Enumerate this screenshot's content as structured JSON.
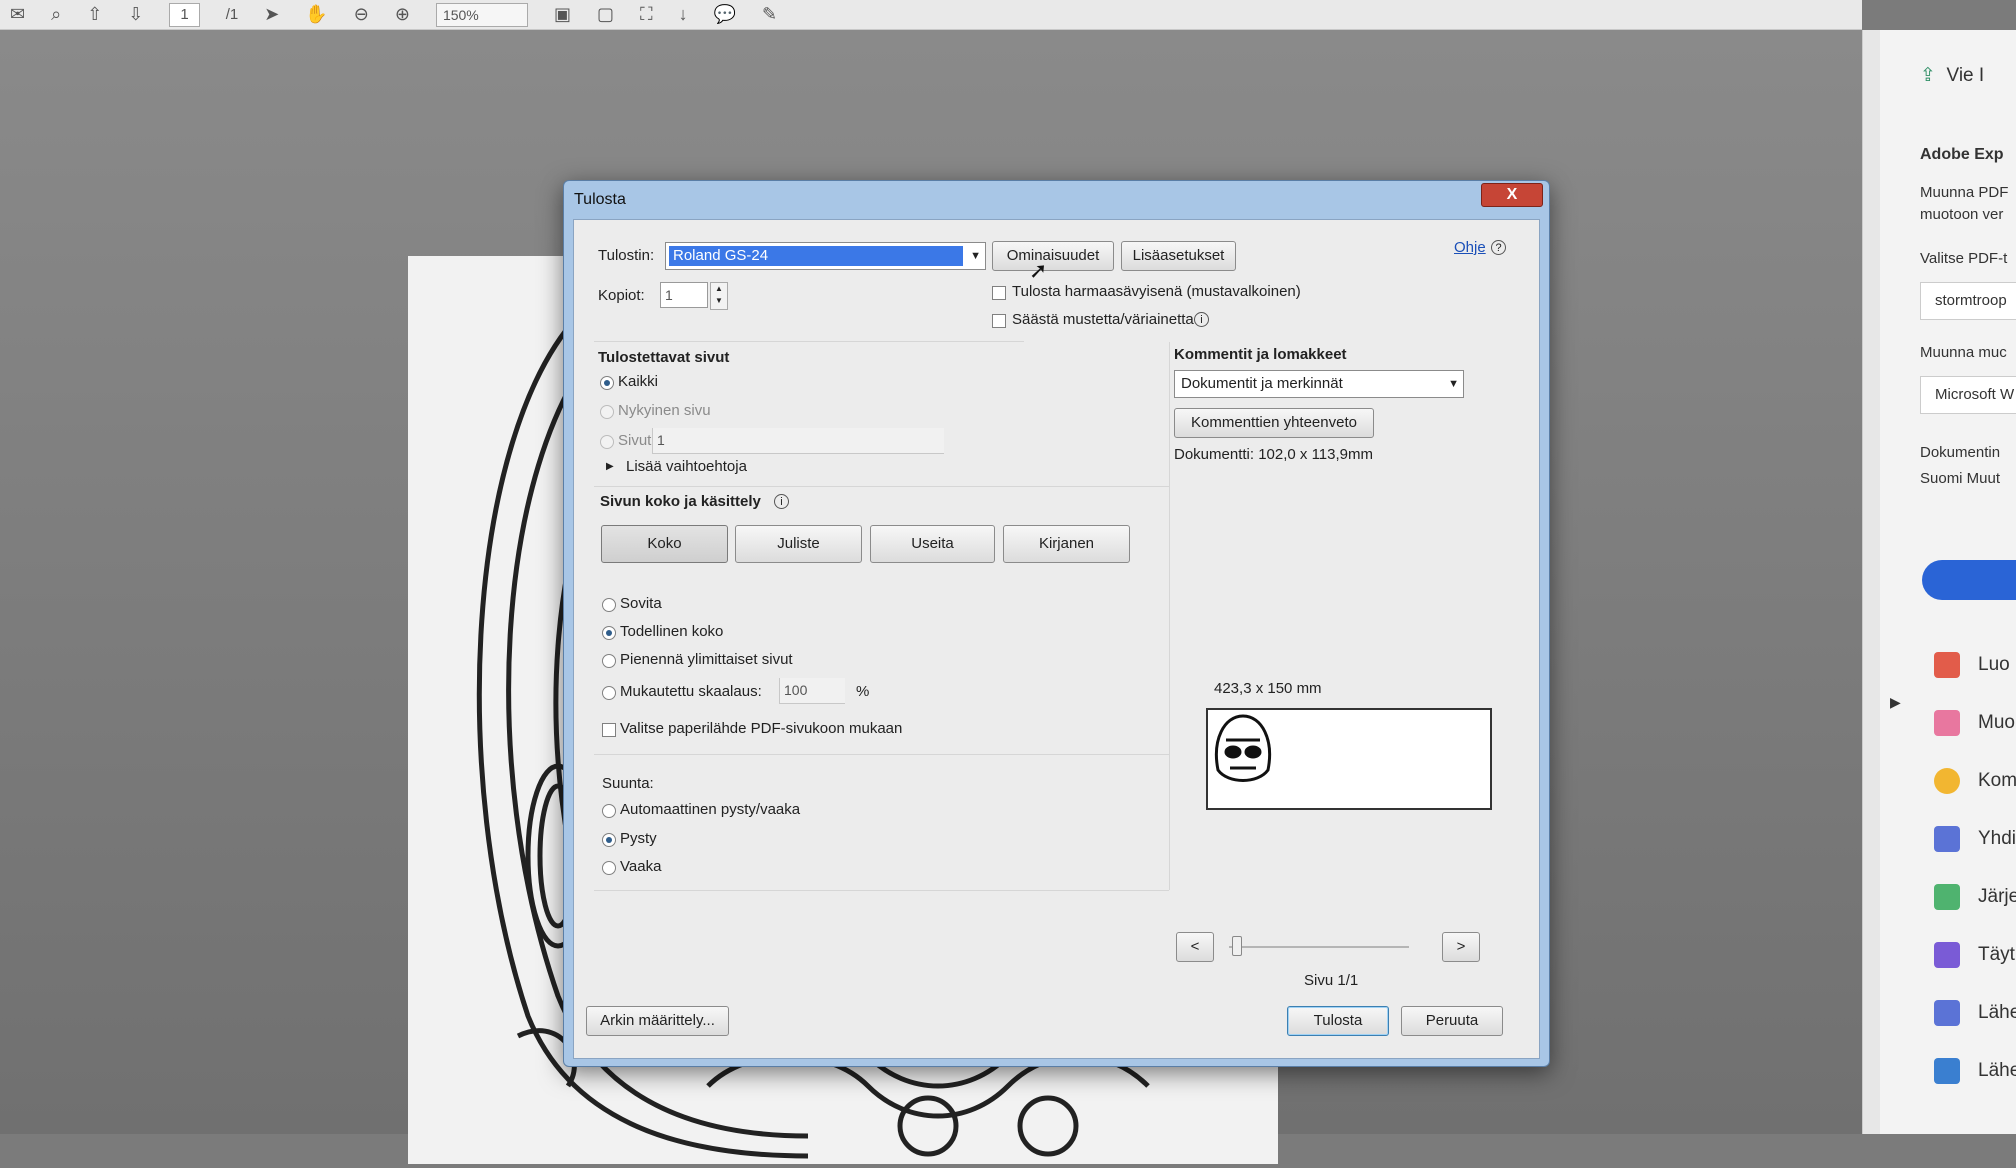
{
  "toolbar": {
    "page_current": "1",
    "page_total": "/1",
    "zoom": "150%"
  },
  "right_pane": {
    "export": "Vie I",
    "adobe_export": "Adobe Exp",
    "convert_line1": "Muunna PDF",
    "convert_line2": "muotoon ver",
    "choose_pdf": "Valitse PDF-t",
    "file_name": "stormtroop",
    "convert_to": "Muunna muc",
    "format": "Microsoft W",
    "doc_lang": "Dokumentin",
    "lang": "Suomi  Muut",
    "tools": [
      "Luo",
      "Muo",
      "Kom",
      "Yhdi",
      "Järje",
      "Täyt",
      "Lähe",
      "Lähe"
    ]
  },
  "dialog": {
    "title": "Tulosta",
    "close": "X",
    "printer_label": "Tulostin:",
    "printer_value": "Roland GS-24",
    "properties_btn": "Ominaisuudet",
    "advanced_btn": "Lisäasetukset",
    "help_link": "Ohje",
    "copies_label": "Kopiot:",
    "copies_value": "1",
    "grayscale_label": "Tulosta harmaasävyisenä (mustavalkoinen)",
    "save_ink_label": "Säästä mustetta/väriainetta",
    "pages_group": "Tulostettavat sivut",
    "all_pages": "Kaikki",
    "current_page": "Nykyinen sivu",
    "pages": "Sivut",
    "pages_value": "1",
    "more_options": "Lisää vaihtoehtoja",
    "size_group": "Sivun koko ja käsittely",
    "size_btn": "Koko",
    "poster_btn": "Juliste",
    "multiple_btn": "Useita",
    "booklet_btn": "Kirjanen",
    "fit": "Sovita",
    "actual_size": "Todellinen koko",
    "shrink": "Pienennä ylimittaiset sivut",
    "custom_scale": "Mukautettu skaalaus:",
    "scale_value": "100",
    "percent": "%",
    "paper_source": "Valitse paperilähde PDF-sivukoon mukaan",
    "orientation_label": "Suunta:",
    "auto_orientation": "Automaattinen pysty/vaaka",
    "portrait": "Pysty",
    "landscape": "Vaaka",
    "comments_group": "Kommentit ja lomakkeet",
    "comments_value": "Dokumentit ja merkinnät",
    "summary_btn": "Kommenttien yhteenveto",
    "document_size": "Dokumentti: 102,0 x 113,9mm",
    "paper_size": "423,3 x 150 mm",
    "prev_btn": "<",
    "next_btn": ">",
    "page_indicator": "Sivu 1/1",
    "page_setup_btn": "Arkin määrittely...",
    "print_btn": "Tulosta",
    "cancel_btn": "Peruuta"
  },
  "colors": {
    "dialog_frame": "#a8c6e6",
    "close_red": "#c64536",
    "selection_blue": "#3b78e7",
    "link_blue": "#1a4fb8",
    "accent_button": "#2a64d6"
  }
}
